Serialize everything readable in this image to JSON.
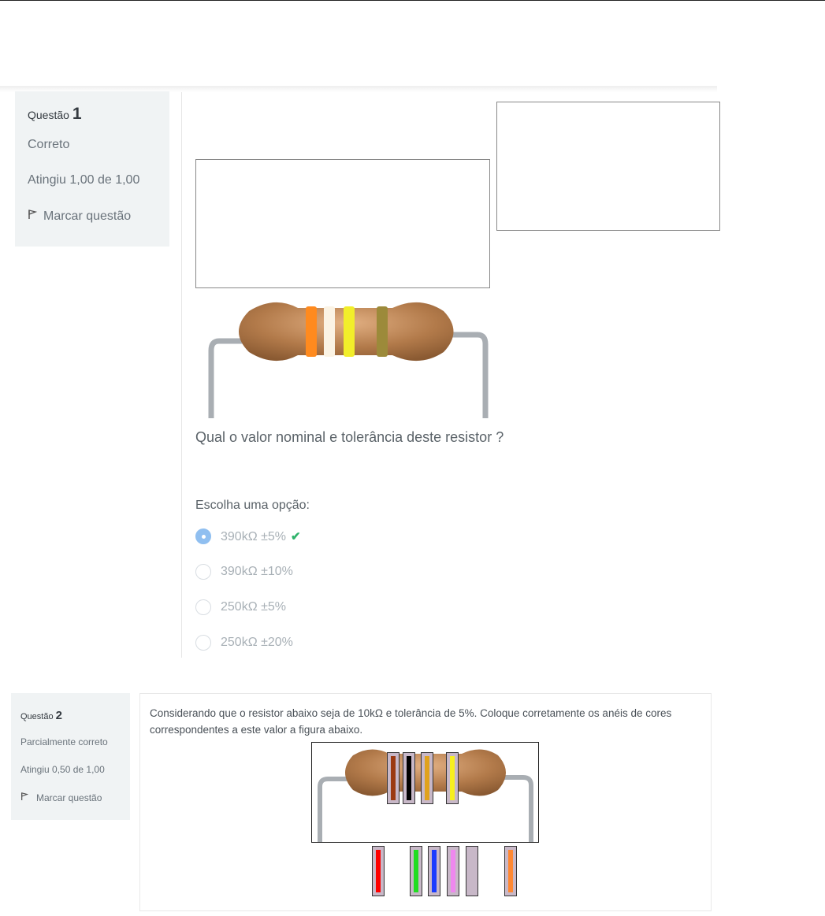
{
  "q1": {
    "number_prefix": "Questão",
    "number": "1",
    "state": "Correto",
    "grade": "Atingiu 1,00 de 1,00",
    "flag_label": "Marcar questão",
    "question_text": "Qual o valor nominal e tolerância deste resistor ?",
    "prompt": "Escolha uma opção:",
    "options": [
      {
        "label": "390kΩ ±5%",
        "checked": true,
        "correct": true
      },
      {
        "label": "390kΩ ±10%",
        "checked": false
      },
      {
        "label": "250kΩ ±5%",
        "checked": false
      },
      {
        "label": "250kΩ ±20%",
        "checked": false
      }
    ],
    "resistor_bands": [
      "#ff8a1e",
      "#fbf3e4",
      "#f2ee2a",
      "#9c8a3a"
    ]
  },
  "q2": {
    "number_prefix": "Questão",
    "number": "2",
    "state": "Parcialmente correto",
    "grade": "Atingiu 0,50 de 1,00",
    "flag_label": "Marcar questão",
    "question_text": "Considerando que o resistor abaixo seja de 10kΩ e tolerância de 5%. Coloque corretamente os anéis de cores correspondentes a este valor a figura abaixo.",
    "placed_rings": [
      "#9b3a12",
      "#000000",
      "#e0a21c",
      "#f7ef1e"
    ],
    "ring_choices": [
      "#ff0000",
      "#22dd22",
      "#1a3cff",
      "#ee88ee",
      "#c8b8c8",
      "#ff8833"
    ]
  },
  "icons": {
    "flag": "flag-icon",
    "check": "check-icon"
  },
  "colors": {
    "info_bg": "#f0f3f4",
    "radio_checked": "#90bff0",
    "check_green": "#2fb36b"
  }
}
